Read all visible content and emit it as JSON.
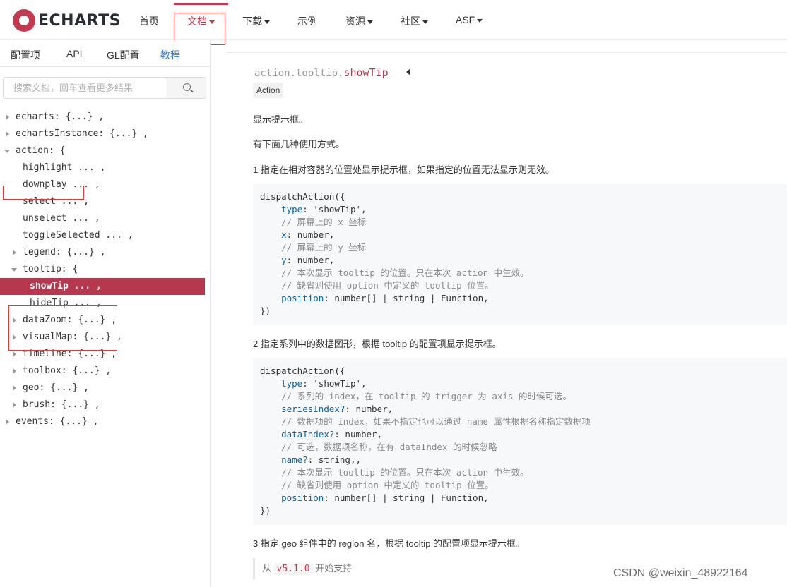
{
  "app": {
    "logo_text": "ECHARTS",
    "brand_color": "#c23a50"
  },
  "nav": {
    "items": [
      {
        "label": "首页",
        "has_caret": false
      },
      {
        "label": "文档",
        "has_caret": true,
        "active": true
      },
      {
        "label": "下载",
        "has_caret": true
      },
      {
        "label": "示例",
        "has_caret": false
      },
      {
        "label": "资源",
        "has_caret": true
      },
      {
        "label": "社区",
        "has_caret": true
      },
      {
        "label": "ASF",
        "has_caret": true
      }
    ]
  },
  "sidebar": {
    "tabs": [
      "配置项",
      "API",
      "GL配置",
      "教程"
    ],
    "current_tab": "教程",
    "search": {
      "placeholder": "搜索文档，回车查看更多结果",
      "icon": "search-icon"
    },
    "tree": [
      {
        "text": "echarts: {...} ,",
        "state": "collapsed",
        "level": 0
      },
      {
        "text": "echartsInstance: {...} ,",
        "state": "collapsed",
        "level": 0
      },
      {
        "text": "action: {",
        "state": "expanded",
        "level": 0
      },
      {
        "text": "highlight ... ,",
        "state": "leaf",
        "level": 1
      },
      {
        "text": "downplay ... ,",
        "state": "leaf",
        "level": 1
      },
      {
        "text": "select ... ,",
        "state": "leaf",
        "level": 1
      },
      {
        "text": "unselect ... ,",
        "state": "leaf",
        "level": 1
      },
      {
        "text": "toggleSelected ... ,",
        "state": "leaf",
        "level": 1
      },
      {
        "text": "legend: {...} ,",
        "state": "collapsed",
        "level": 1
      },
      {
        "text": "tooltip: {",
        "state": "expanded",
        "level": 1
      },
      {
        "text": "showTip ... ,",
        "state": "leaf",
        "level": 2,
        "selected": true
      },
      {
        "text": "hideTip ... ,",
        "state": "leaf",
        "level": 2
      },
      {
        "text": "dataZoom: {...} ,",
        "state": "collapsed",
        "level": 1
      },
      {
        "text": "visualMap: {...} ,",
        "state": "collapsed",
        "level": 1
      },
      {
        "text": "timeline: {...} ,",
        "state": "collapsed",
        "level": 1
      },
      {
        "text": "toolbox: {...} ,",
        "state": "collapsed",
        "level": 1
      },
      {
        "text": "geo: {...} ,",
        "state": "collapsed",
        "level": 1
      },
      {
        "text": "brush: {...} ,",
        "state": "collapsed",
        "level": 1
      },
      {
        "text": "events: {...} ,",
        "state": "collapsed",
        "level": 0
      }
    ]
  },
  "doc": {
    "path_prefix": "action.tooltip.",
    "path_key": "showTip",
    "tag": "Action",
    "p1": "显示提示框。",
    "p2": "有下面几种使用方式。",
    "p3": "1 指定在相对容器的位置处显示提示框，如果指定的位置无法显示则无效。",
    "code1": [
      "dispatchAction({",
      "    type: 'showTip',",
      "    // 屏幕上的 x 坐标",
      "    x: number,",
      "    // 屏幕上的 y 坐标",
      "    y: number,",
      "    // 本次显示 tooltip 的位置。只在本次 action 中生效。",
      "    // 缺省则使用 option 中定义的 tooltip 位置。",
      "    position: number[] | string | Function,",
      "})"
    ],
    "p4": "2 指定系列中的数据图形，根据 tooltip 的配置项显示提示框。",
    "code2": [
      "dispatchAction({",
      "    type: 'showTip',",
      "    // 系列的 index，在 tooltip 的 trigger 为 axis 的时候可选。",
      "    seriesIndex?: number,",
      "    // 数据项的 index，如果不指定也可以通过 name 属性根据名称指定数据项",
      "    dataIndex?: number,",
      "    // 可选，数据项名称，在有 dataIndex 的时候忽略",
      "    name?: string,,",
      "    // 本次显示 tooltip 的位置。只在本次 action 中生效。",
      "    // 缺省则使用 option 中定义的 tooltip 位置。",
      "    position: number[] | string | Function,",
      "})"
    ],
    "p5": "3 指定 geo 组件中的 region 名，根据 tooltip 的配置项显示提示框。",
    "since_prefix": "从",
    "since_version": "v5.1.0",
    "since_suffix": "开始支持"
  },
  "watermark": "CSDN @weixin_48922164"
}
